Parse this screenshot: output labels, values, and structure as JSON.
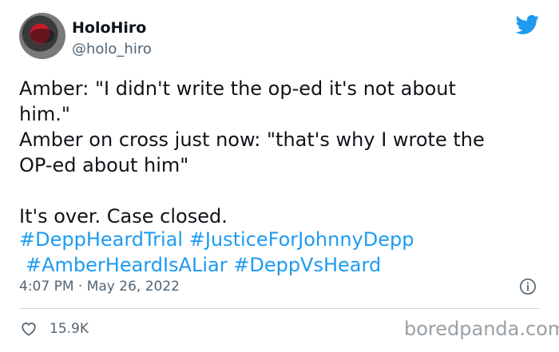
{
  "tweet": {
    "display_name": "HoloHiro",
    "handle": "@holo_hiro",
    "text": "Amber: \"I didn't write the op-ed it's not about\nhim.\"\nAmber on cross just now: \"that's why I wrote the\nOP-ed about him\"\n\nIt's over. Case closed.",
    "hashtags": [
      "#DeppHeardTrial",
      "#JusticeForJohnnyDepp",
      "#AmberHeardIsALiar",
      "#DeppVsHeard"
    ],
    "timestamp": "4:07 PM · May 26, 2022",
    "likes": "15.9K"
  },
  "icons": {
    "logo": "twitter-bird-icon",
    "info": "info-icon",
    "like": "heart-icon"
  },
  "colors": {
    "accent": "#1d9bf0",
    "text": "#0f1419",
    "muted": "#536471"
  },
  "watermark": "boredpanda.com"
}
